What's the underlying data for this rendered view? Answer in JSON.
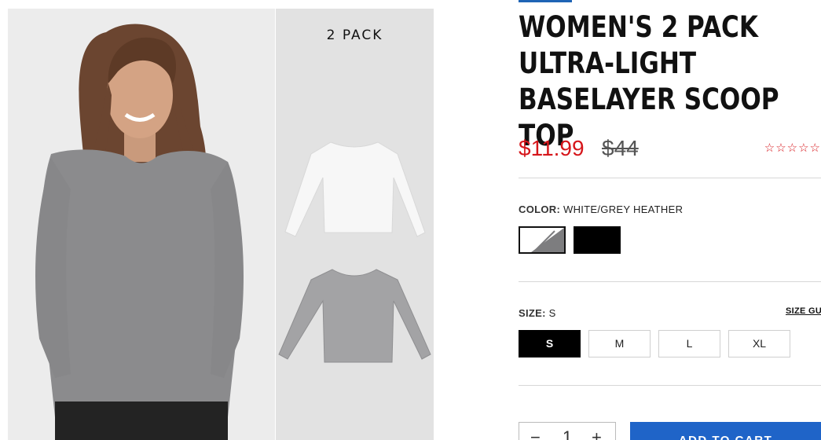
{
  "gallery": {
    "pack_label": "2 PACK"
  },
  "product": {
    "title": "WOMEN'S 2 PACK ULTRA-LIGHT BASELAYER SCOOP TOP",
    "sale_price": "$11.99",
    "original_price": "$44",
    "rating_stars": "☆☆☆☆☆"
  },
  "color": {
    "label": "COLOR:",
    "value": "WHITE/GREY HEATHER",
    "swatches": [
      {
        "name": "White/Grey Heather",
        "selected": true
      },
      {
        "name": "Black",
        "selected": false
      }
    ]
  },
  "size": {
    "label": "SIZE:",
    "value": "S",
    "guide_label": "SIZE GU",
    "options": [
      "S",
      "M",
      "L",
      "XL"
    ],
    "selected": "S"
  },
  "cart": {
    "quantity": "1",
    "minus": "−",
    "plus": "+",
    "add_label": "ADD TO CART"
  },
  "colors": {
    "accent": "#1f64b5",
    "sale": "#d6161b",
    "button": "#1f64c8"
  }
}
